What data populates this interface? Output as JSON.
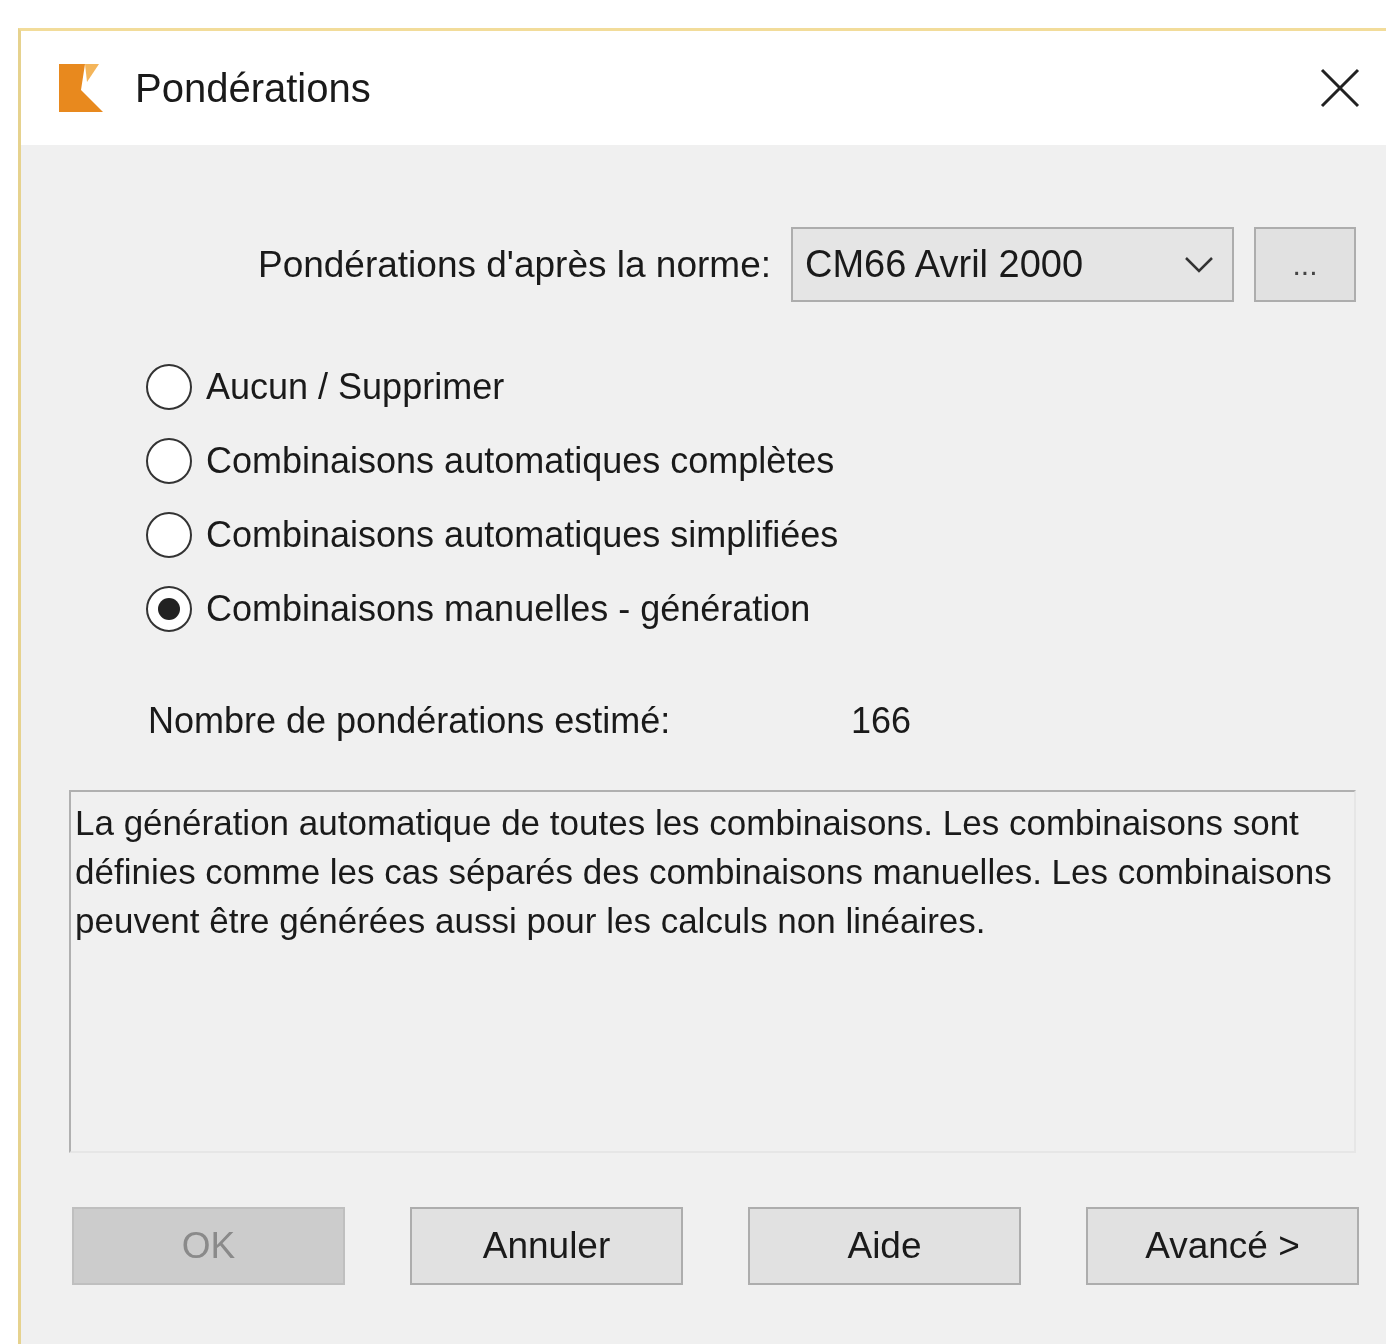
{
  "window": {
    "title": "Pondérations"
  },
  "norm": {
    "label": "Pondérations d'après la norme:",
    "value": "CM66 Avril 2000",
    "browse_button": "..."
  },
  "options": [
    {
      "label": "Aucun / Supprimer",
      "selected": false
    },
    {
      "label": "Combinaisons automatiques complètes",
      "selected": false
    },
    {
      "label": "Combinaisons automatiques simplifiées",
      "selected": false
    },
    {
      "label": "Combinaisons manuelles - génération",
      "selected": true
    }
  ],
  "estimate": {
    "label": "Nombre de pondérations estimé:",
    "value": "166"
  },
  "description": "La génération automatique de toutes les combinaisons. Les combinaisons sont définies comme les cas séparés des combinaisons manuelles. Les combinaisons peuvent être générées aussi pour les calculs non linéaires.",
  "buttons": [
    {
      "label": "OK",
      "disabled": true
    },
    {
      "label": "Annuler",
      "disabled": false
    },
    {
      "label": "Aide",
      "disabled": false
    },
    {
      "label": "Avancé >",
      "disabled": false
    }
  ]
}
